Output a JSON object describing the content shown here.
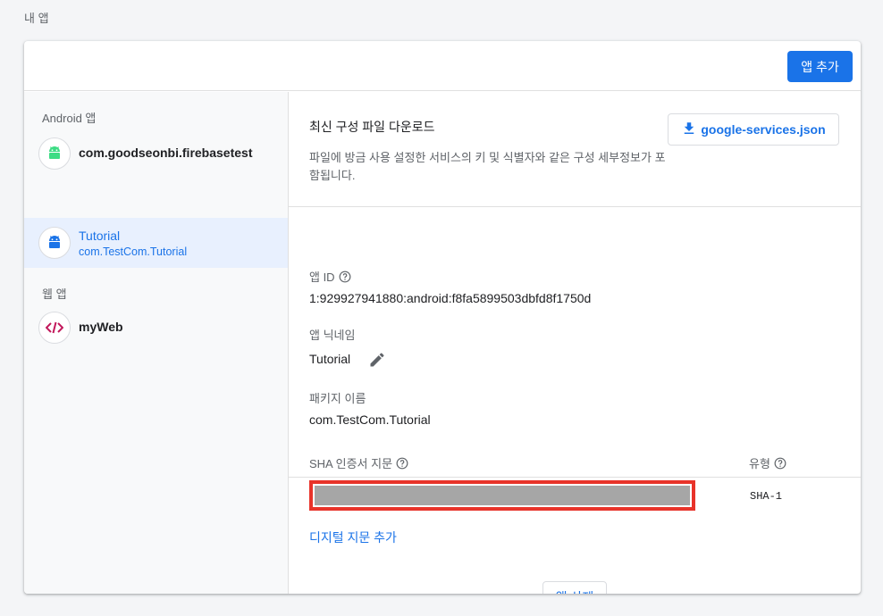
{
  "page": {
    "heading": "내 앱"
  },
  "toolbar": {
    "add_app_label": "앱 추가"
  },
  "sidebar": {
    "android_section_label": "Android 앱",
    "web_section_label": "웹 앱",
    "android_apps": [
      {
        "name": "com.goodseonbi.firebasetest",
        "subtitle": "",
        "icon": "android-icon"
      },
      {
        "name": "Tutorial",
        "subtitle": "com.TestCom.Tutorial",
        "icon": "android-icon",
        "selected": true
      }
    ],
    "web_apps": [
      {
        "name": "myWeb",
        "icon": "code-icon"
      }
    ]
  },
  "config": {
    "title": "최신 구성 파일 다운로드",
    "description": "파일에 방금 사용 설정한 서비스의 키 및 식별자와 같은 구성 세부정보가 포함됩니다.",
    "download_label": "google-services.json"
  },
  "details": {
    "app_id_label": "앱 ID",
    "app_id_value": "1:929927941880:android:f8fa5899503dbfd8f1750d",
    "nickname_label": "앱 닉네임",
    "nickname_value": "Tutorial",
    "package_label": "패키지 이름",
    "package_value": "com.TestCom.Tutorial"
  },
  "sha": {
    "fingerprint_label": "SHA 인증서 지문",
    "type_label": "유형",
    "type_value": "SHA-1",
    "add_fingerprint_label": "디지털 지문 추가"
  },
  "actions": {
    "delete_label": "앱 삭제"
  },
  "colors": {
    "accent": "#1a73e8",
    "android": "#3ddc84",
    "web": "#c2185b",
    "highlight_border": "#e8332a"
  }
}
